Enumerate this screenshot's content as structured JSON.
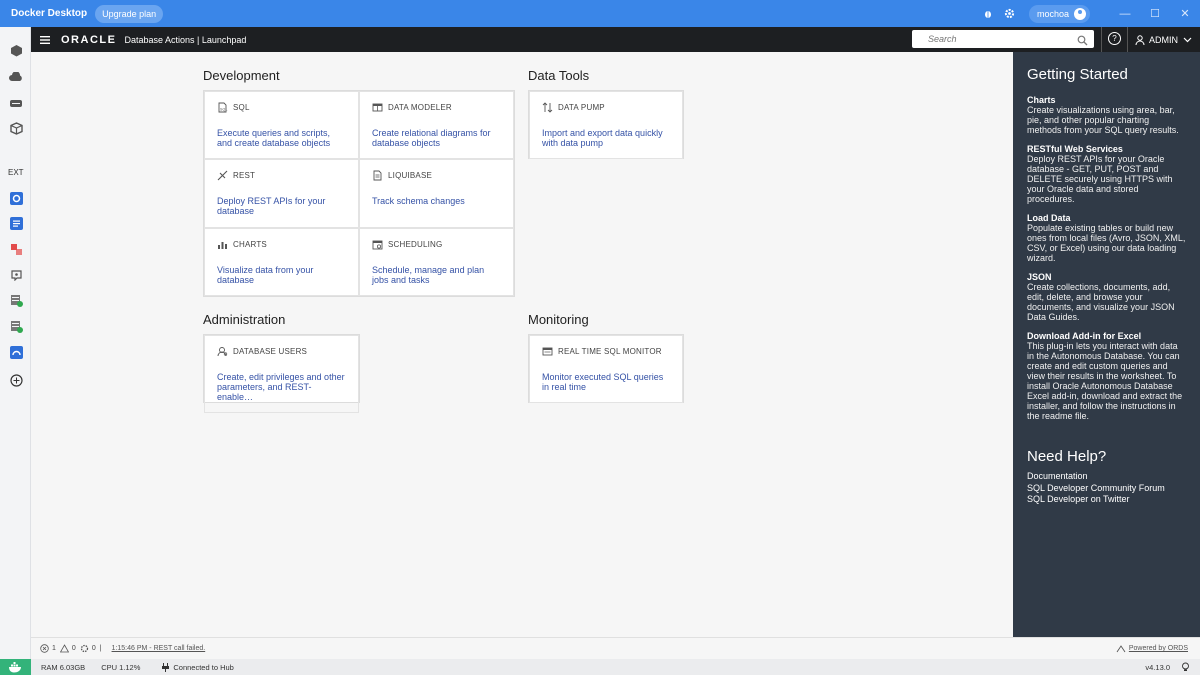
{
  "docker": {
    "app_name": "Docker Desktop",
    "upgrade_label": "Upgrade plan",
    "user": "mochoa",
    "window_controls": [
      "—",
      "☐",
      "✕"
    ]
  },
  "oracle_header": {
    "logo": "ORACLE",
    "breadcrumb": "Database Actions |  Launchpad",
    "search_placeholder": "Search",
    "help_label": "?",
    "user": "ADMIN"
  },
  "sections": {
    "development": {
      "title": "Development",
      "cards": [
        {
          "label": "SQL",
          "desc": "Execute queries and scripts, and create database objects",
          "icon": "sql-worksheet-icon"
        },
        {
          "label": "DATA MODELER",
          "desc": "Create relational diagrams for database objects",
          "icon": "data-modeler-icon"
        },
        {
          "label": "REST",
          "desc": "Deploy REST APIs for your database",
          "icon": "rest-icon"
        },
        {
          "label": "LIQUIBASE",
          "desc": "Track schema changes",
          "icon": "liquibase-icon"
        },
        {
          "label": "CHARTS",
          "desc": "Visualize data from your database",
          "icon": "charts-icon"
        },
        {
          "label": "SCHEDULING",
          "desc": "Schedule, manage and plan jobs and tasks",
          "icon": "scheduling-icon"
        }
      ]
    },
    "data_tools": {
      "title": "Data Tools",
      "cards": [
        {
          "label": "DATA PUMP",
          "desc": "Import and export data quickly with data pump",
          "icon": "data-pump-icon"
        }
      ]
    },
    "administration": {
      "title": "Administration",
      "cards": [
        {
          "label": "DATABASE USERS",
          "desc": "Create, edit privileges and other parameters, and REST-enable…",
          "icon": "database-users-icon"
        }
      ]
    },
    "monitoring": {
      "title": "Monitoring",
      "cards": [
        {
          "label": "REAL TIME SQL MONITOR",
          "desc": "Monitor executed SQL queries in real time",
          "icon": "sql-monitor-icon"
        }
      ]
    }
  },
  "getting_started": {
    "title": "Getting Started",
    "items": [
      {
        "title": "Charts",
        "desc": "Create visualizations using area, bar, pie, and other popular charting methods from your SQL query results."
      },
      {
        "title": "RESTful Web Services",
        "desc": "Deploy REST APIs for your Oracle database - GET, PUT, POST and DELETE securely using HTTPS with your Oracle data and stored procedures."
      },
      {
        "title": "Load Data",
        "desc": "Populate existing tables or build new ones from local files (Avro, JSON, XML, CSV, or Excel) using our data loading wizard."
      },
      {
        "title": "JSON",
        "desc": "Create collections, documents, add, edit, delete, and browse your documents, and visualize your JSON Data Guides."
      },
      {
        "title": "Download Add-in for Excel",
        "desc": "This plug-in lets you interact with data in the Autonomous Database. You can create and edit custom queries and view their results in the worksheet. To install Oracle Autonomous Database Excel add-in, download and extract the installer, and follow the instructions in the readme file."
      }
    ],
    "help_title": "Need Help?",
    "help_links": [
      "Documentation",
      "SQL Developer Community Forum",
      "SQL Developer on Twitter"
    ]
  },
  "oracle_footer": {
    "errors": "1",
    "warnings": "0",
    "processes": "0",
    "divider": "|",
    "status": "1:15:46 PM - REST call failed.",
    "powered_by": "Powered by ORDS"
  },
  "docker_status": {
    "ram": "RAM 6.03GB",
    "cpu": "CPU 1.12%",
    "hub": "Connected to Hub",
    "version": "v4.13.0"
  },
  "colors": {
    "docker_blue": "#3a86e8",
    "oracle_header": "#1d1f22",
    "panel_dark": "#303a47",
    "link_blue": "#3552a6",
    "docker_green": "#33b37a"
  }
}
